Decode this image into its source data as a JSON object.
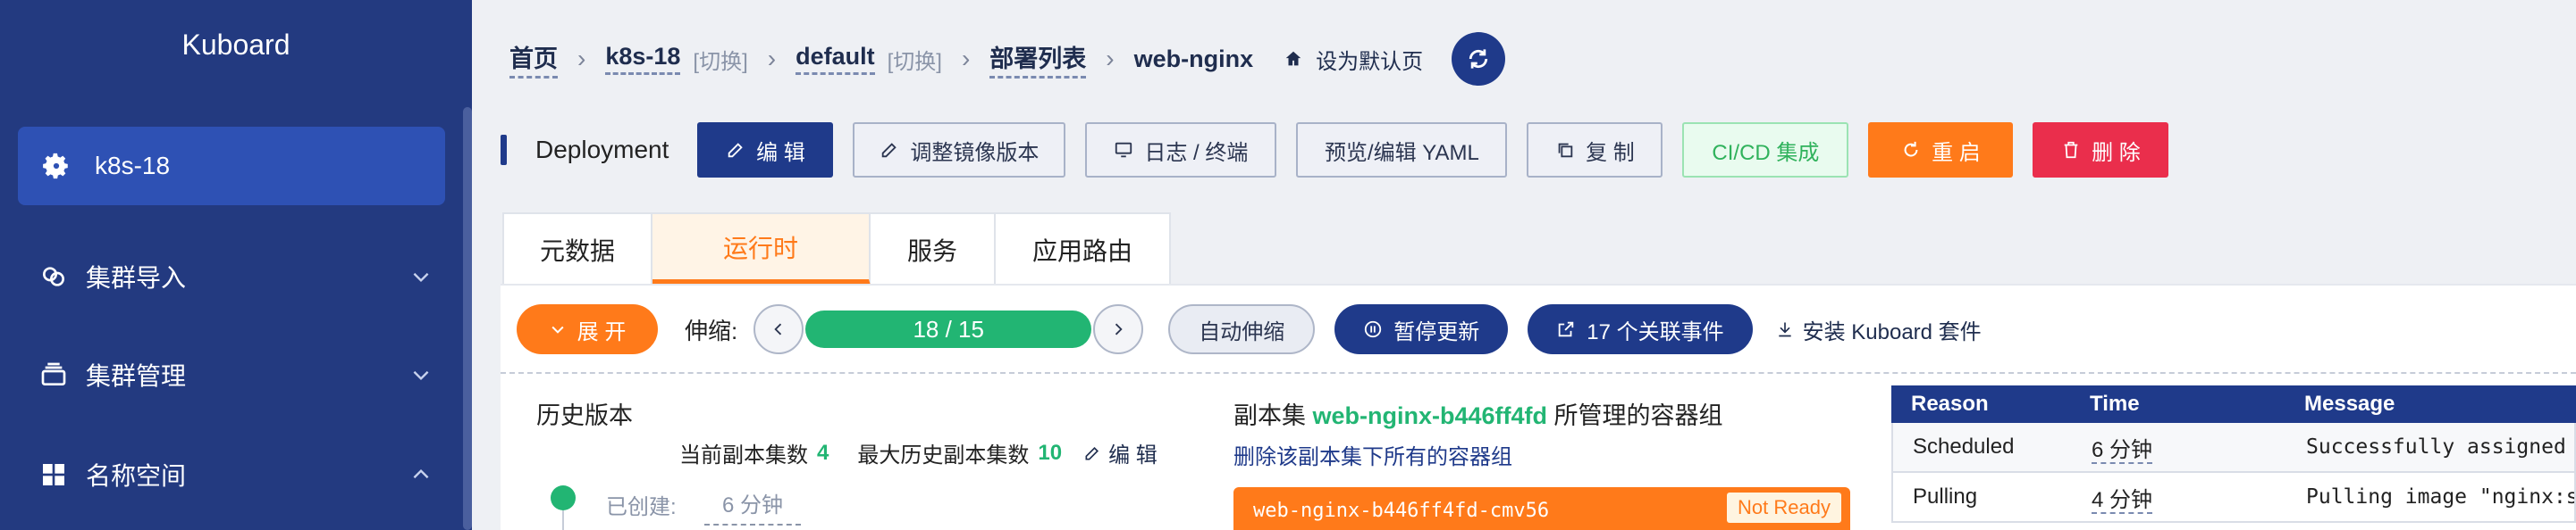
{
  "sidebar": {
    "brand": "Kuboard",
    "cluster": "k8s-18",
    "items": [
      {
        "label": "集群导入"
      },
      {
        "label": "集群管理"
      },
      {
        "label": "名称空间"
      }
    ]
  },
  "breadcrumb": {
    "home": "首页",
    "cluster": "k8s-18",
    "cluster_switch": "[切换]",
    "namespace": "default",
    "namespace_switch": "[切换]",
    "deploy_list": "部署列表",
    "current": "web-nginx",
    "set_default": "设为默认页"
  },
  "toolbar": {
    "kind": "Deployment",
    "edit": "编 辑",
    "adjust_image": "调整镜像版本",
    "logs": "日志 / 终端",
    "yaml": "预览/编辑 YAML",
    "copy": "复 制",
    "cicd": "CI/CD 集成",
    "restart": "重 启",
    "delete": "删 除"
  },
  "tabs": [
    "元数据",
    "运行时",
    "服务",
    "应用路由"
  ],
  "controls": {
    "expand": "展 开",
    "scale_label": "伸缩:",
    "replicas": "18 / 15",
    "autoscale": "自动伸缩",
    "pause": "暂停更新",
    "events": "17 个关联事件",
    "install": "安装 Kuboard 套件"
  },
  "history": {
    "title": "历史版本",
    "current_label": "当前副本集数",
    "current_value": "4",
    "max_label": "最大历史副本集数",
    "max_value": "10",
    "edit": "编 辑",
    "created_label": "已创建:",
    "created_value": "6 分钟"
  },
  "replicaset": {
    "prefix": "副本集",
    "name": "web-nginx-b446ff4fd",
    "suffix": "所管理的容器组",
    "delete_link": "删除该副本集下所有的容器组",
    "pod": "web-nginx-b446ff4fd-cmv56",
    "pod_status": "Not Ready"
  },
  "events_table": {
    "headers": [
      "Reason",
      "Time",
      "Message"
    ],
    "rows": [
      {
        "reason": "Scheduled",
        "time": "6 分钟",
        "message": "Successfully assigned c"
      },
      {
        "reason": "Pulling",
        "time": "4 分钟",
        "message": "Pulling image \"nginx:sc"
      }
    ]
  },
  "colors": {
    "sidebar_bg": "#233a80",
    "primary": "#1f3a8a",
    "accent_orange": "#ff7a1a",
    "success_green": "#22b573",
    "danger_red": "#ea2e4c"
  }
}
